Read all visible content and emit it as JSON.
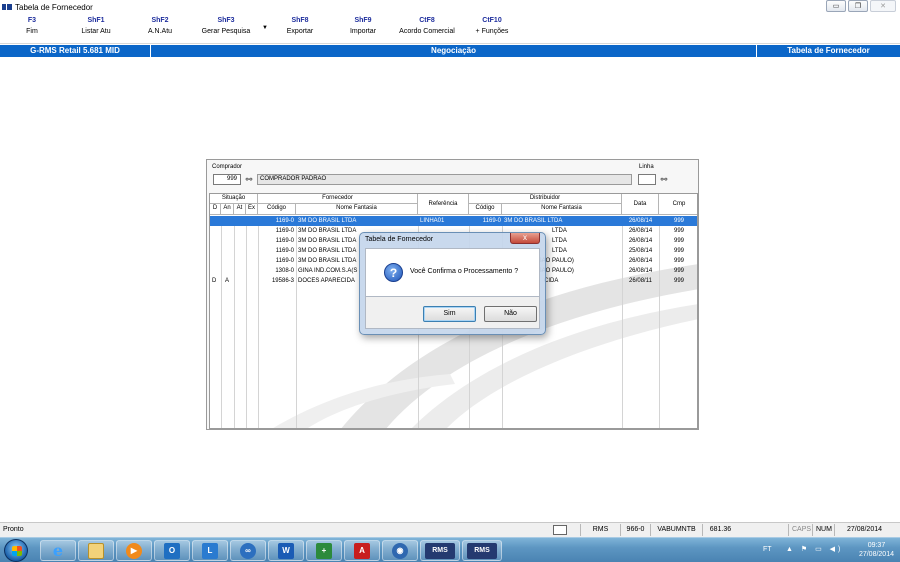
{
  "window": {
    "title": "Tabela de Fornecedor"
  },
  "toolbar": {
    "items": [
      {
        "key": "F3",
        "label": "Fim"
      },
      {
        "key": "ShF1",
        "label": "Listar Atu"
      },
      {
        "key": "ShF2",
        "label": "A.N.Atu"
      },
      {
        "key": "ShF3",
        "label": "Gerar Pesquisa"
      },
      {
        "key": "ShF8",
        "label": "Exportar"
      },
      {
        "key": "ShF9",
        "label": "Importar"
      },
      {
        "key": "CtF8",
        "label": "Acordo Comercial"
      },
      {
        "key": "CtF10",
        "label": "+ Funções"
      }
    ]
  },
  "header": {
    "app": "G-RMS Retail 5.681 MID",
    "module": "Negociação",
    "screen": "Tabela de Fornecedor"
  },
  "filters": {
    "comprador_label": "Comprador",
    "comprador_code": "999",
    "comprador_name": "COMPRADOR PADRAO",
    "linha_label": "Linha",
    "linha_value": ""
  },
  "grid": {
    "group_situacao": "Situação",
    "group_fornecedor": "Fornecedor",
    "group_distribuidor": "Distribuidor",
    "col_d": "D",
    "col_an": "An",
    "col_at": "At",
    "col_ex": "Ex",
    "col_codigo": "Código",
    "col_nome": "Nome Fantasia",
    "col_referencia": "Referência",
    "col_dist_codigo": "Código",
    "col_dist_nome": "Nome Fantasia",
    "col_data": "Data",
    "col_cmp": "Cmp",
    "rows": [
      {
        "d": "",
        "an": "",
        "at": "",
        "ex": "",
        "codigo": "1169-0",
        "nome": "3M DO BRASIL LTDA",
        "ref": "LINHA01",
        "dcod": "1169-0",
        "dnome": "3M DO BRASIL LTDA",
        "data": "26/08/14",
        "cmp": "999",
        "selected": true
      },
      {
        "d": "",
        "an": "",
        "at": "",
        "ex": "",
        "codigo": "1169-0",
        "nome": "3M DO BRASIL LTDA",
        "ref": "",
        "dcod": "",
        "dnome": "LTDA",
        "data": "26/08/14",
        "cmp": "999"
      },
      {
        "d": "",
        "an": "",
        "at": "",
        "ex": "",
        "codigo": "1169-0",
        "nome": "3M DO BRASIL LTDA",
        "ref": "",
        "dcod": "",
        "dnome": "LTDA",
        "data": "26/08/14",
        "cmp": "999"
      },
      {
        "d": "",
        "an": "",
        "at": "",
        "ex": "",
        "codigo": "1169-0",
        "nome": "3M DO BRASIL LTDA",
        "ref": "",
        "dcod": "",
        "dnome": "LTDA",
        "data": "25/08/14",
        "cmp": "999"
      },
      {
        "d": "",
        "an": "",
        "at": "",
        "ex": "",
        "codigo": "1169-0",
        "nome": "3M DO BRASIL LTDA",
        "ref": "",
        "dcod": "",
        "dnome": "S.A(SAO PAULO)",
        "data": "26/08/14",
        "cmp": "999"
      },
      {
        "d": "",
        "an": "",
        "at": "",
        "ex": "",
        "codigo": "1308-0",
        "nome": "GINA IND.COM.S.A(S",
        "ref": "",
        "dcod": "",
        "dnome": "S.A(SAO PAULO)",
        "data": "26/08/14",
        "cmp": "999"
      },
      {
        "d": "D",
        "an": "A",
        "at": "",
        "ex": "",
        "codigo": "19586-3",
        "nome": "DOCES APARECIDA",
        "ref": "",
        "dcod": "",
        "dnome": "CIDA",
        "data": "26/08/11",
        "cmp": "999"
      }
    ]
  },
  "dialog": {
    "title": "Tabela de Fornecedor",
    "close": "x",
    "message": "Você Confirma o Processamento ?",
    "yes": "Sim",
    "no": "Não"
  },
  "statusbar": {
    "status": "Pronto",
    "system": "RMS",
    "store": "966-0",
    "user": "VABUMNTB",
    "version": "681.36 v5",
    "caps": "CAPS",
    "num": "NUM",
    "date": "27/08/2014"
  },
  "taskbar": {
    "lang": "FT",
    "time": "09:37",
    "date": "27/08/2014"
  }
}
